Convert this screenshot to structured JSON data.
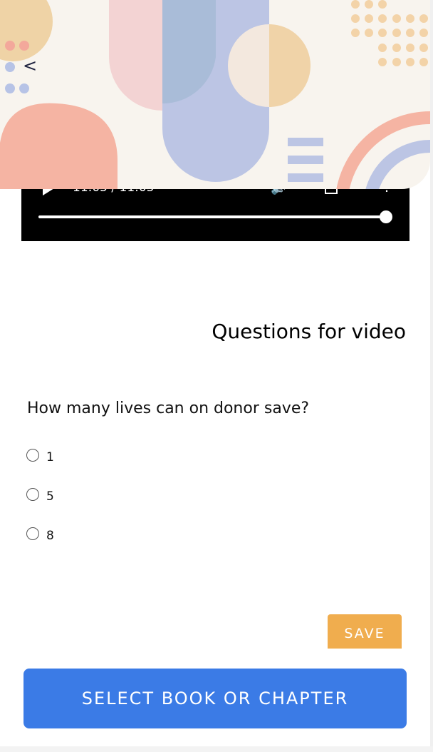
{
  "video": {
    "time_display": "11:05 / 11:05",
    "progress": 1.0
  },
  "header": {
    "back_icon": "<"
  },
  "questions": {
    "title": "Questions for video",
    "prompt": "How many lives can on donor save?",
    "options": [
      "1",
      "5",
      "8"
    ],
    "save_label": "SAVE"
  },
  "footer": {
    "select_label": "SELECT BOOK OR CHAPTER"
  },
  "colors": {
    "save_button": "#f0ad4e",
    "select_button": "#3b7be6",
    "header_bg": "#f8f4ee"
  },
  "icons": {
    "back": "chevron-left-icon",
    "play": "play-icon",
    "volume": "volume-icon",
    "fullscreen": "fullscreen-icon",
    "more": "more-vertical-icon"
  }
}
